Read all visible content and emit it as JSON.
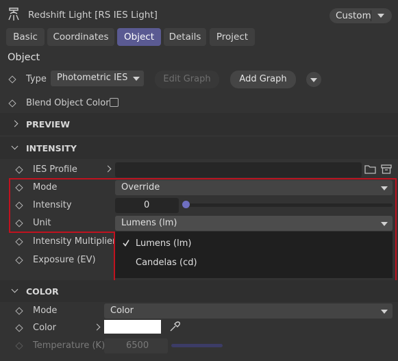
{
  "header": {
    "title": "Redshift Light [RS IES Light]",
    "preset": "Custom"
  },
  "tabs": [
    {
      "label": "Basic"
    },
    {
      "label": "Coordinates"
    },
    {
      "label": "Object"
    },
    {
      "label": "Details"
    },
    {
      "label": "Project"
    }
  ],
  "active_tab": "Object",
  "object": {
    "heading": "Object",
    "type_label": "Type",
    "type_value": "Photometric IES",
    "edit_graph": "Edit Graph",
    "add_graph": "Add Graph",
    "blend_label": "Blend Object Color",
    "blend_checked": false
  },
  "preview": {
    "title": "PREVIEW"
  },
  "intensity": {
    "title": "INTENSITY",
    "ies_profile_label": "IES Profile",
    "ies_profile_value": "",
    "mode_label": "Mode",
    "mode_value": "Override",
    "intensity_label": "Intensity",
    "intensity_value": "0",
    "intensity_slider_fraction": 0,
    "unit_label": "Unit",
    "unit_value": "Lumens (lm)",
    "unit_options": [
      "Lumens (lm)",
      "Candelas (cd)"
    ],
    "unit_selected": "Lumens (lm)",
    "multiplier_label": "Intensity Multiplier",
    "exposure_label": "Exposure (EV)"
  },
  "color": {
    "title": "COLOR",
    "mode_label": "Mode",
    "mode_value": "Color",
    "color_label": "Color",
    "color_swatch": "#ffffff",
    "temperature_label": "Temperature (K)",
    "temperature_value": "6500"
  },
  "colors": {
    "accent_tab": "#5a5a92",
    "highlight_frame": "#c1121f",
    "slider_knob": "#6f6fc0"
  }
}
